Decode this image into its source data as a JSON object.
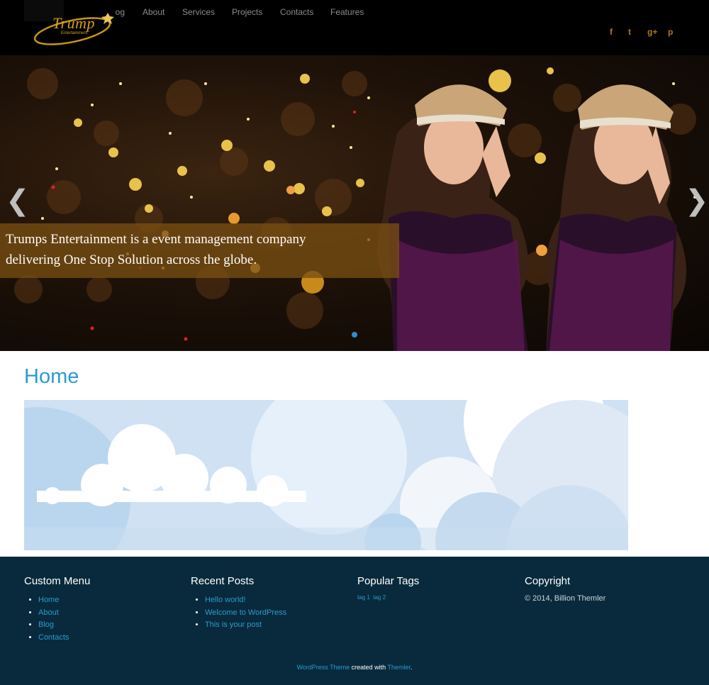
{
  "header": {
    "logo_text": "Trump",
    "logo_sub": "Entertainment",
    "nav": [
      "Blog",
      "About",
      "Services",
      "Projects",
      "Contacts",
      "Features"
    ],
    "social": [
      "f",
      "t",
      "g+",
      "p"
    ]
  },
  "slider": {
    "caption_line1": "Trumps Entertainment is a event management company",
    "caption_line2": "delivering One Stop Solution across the globe.",
    "prev_glyph": "❮",
    "next_glyph": "❯"
  },
  "main": {
    "title": "Home"
  },
  "footer": {
    "custom_menu": {
      "title": "Custom Menu",
      "items": [
        "Home",
        "About",
        "Blog",
        "Contacts"
      ]
    },
    "recent_posts": {
      "title": "Recent Posts",
      "items": [
        "Hello world!",
        "Welcome to WordPress",
        "This is your post"
      ]
    },
    "popular_tags": {
      "title": "Popular Tags",
      "tags": "tag 1  tag 2"
    },
    "copyright": {
      "title": "Copyright",
      "text": "© 2014, Billion Themler"
    },
    "credit": {
      "link1": "WordPress Theme",
      "middle": " created with ",
      "link2": "Themler",
      "end": "."
    }
  },
  "colors": {
    "accent": "#2a9bd1",
    "footer_bg": "#082a3c",
    "header_bg": "#000000",
    "caption_bg": "#784e12",
    "gold": "#d4a017"
  }
}
